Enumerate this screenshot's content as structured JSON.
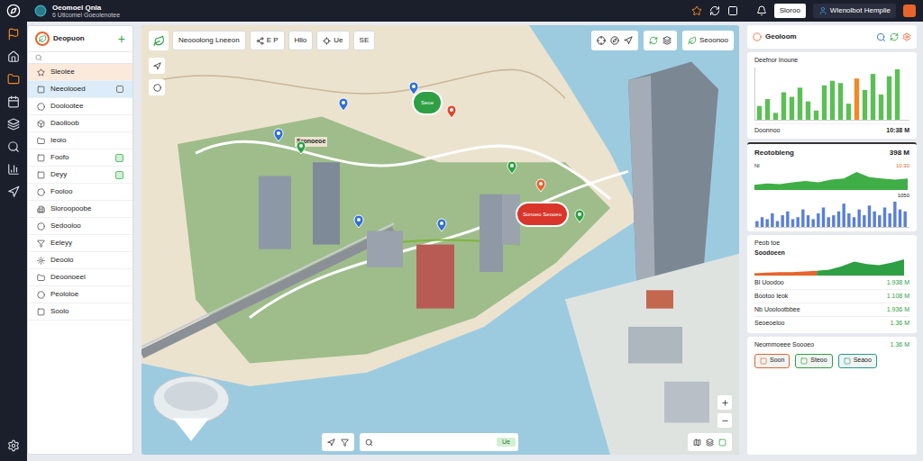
{
  "app": {
    "title": "Oeomoel Qnla",
    "subtitle": "6 Utlcomel Goeolenotee"
  },
  "rail": [
    {
      "active": true
    },
    {
      "active": false
    },
    {
      "active": true
    },
    {
      "active": false
    },
    {
      "active": false
    },
    {
      "active": false
    },
    {
      "active": false
    },
    {
      "active": false
    },
    {
      "active": false
    }
  ],
  "topbar": {
    "buttons": [
      {
        "label": "Sloroo"
      },
      {
        "label": "Wlenolbot Hemplie"
      }
    ]
  },
  "sidebar": {
    "title": "Deopuon",
    "add": "+",
    "items": [
      {
        "label": "Sleolee",
        "selected": false,
        "highlighted": true,
        "marker": "none"
      },
      {
        "label": "Neeolooed",
        "selected": true,
        "highlighted": false,
        "marker": "outline"
      },
      {
        "label": "Doolootee",
        "selected": false,
        "highlighted": false,
        "marker": "none"
      },
      {
        "label": "Daolloob",
        "selected": false,
        "highlighted": false,
        "marker": "none"
      },
      {
        "label": "Ieoio",
        "selected": false,
        "highlighted": false,
        "marker": "none"
      },
      {
        "label": "Foofo",
        "selected": false,
        "highlighted": false,
        "marker": "green"
      },
      {
        "label": "Deyy",
        "selected": false,
        "highlighted": false,
        "marker": "green"
      },
      {
        "label": "Fooloo",
        "selected": false,
        "highlighted": false,
        "marker": "none"
      },
      {
        "label": "Sloroopoobe",
        "selected": false,
        "highlighted": false,
        "marker": "none"
      },
      {
        "label": "Sedooloo",
        "selected": false,
        "highlighted": false,
        "marker": "none"
      },
      {
        "label": "Eeleyy",
        "selected": false,
        "highlighted": false,
        "marker": "none"
      },
      {
        "label": "Deoolo",
        "selected": false,
        "highlighted": false,
        "marker": "none"
      },
      {
        "label": "Deoonoeel",
        "selected": false,
        "highlighted": false,
        "marker": "none"
      },
      {
        "label": "Peololoe",
        "selected": false,
        "highlighted": false,
        "marker": "none"
      },
      {
        "label": "Soolo",
        "selected": false,
        "highlighted": false,
        "marker": "none"
      }
    ]
  },
  "map": {
    "toolbar": {
      "chips": [
        {
          "label": "Neooolong Lneeon"
        },
        {
          "label": "E P"
        },
        {
          "label": "Hllo"
        },
        {
          "label": "Ue"
        },
        {
          "label": "SE"
        }
      ],
      "layer": "Seoonoo"
    },
    "place_label": "Sronoeoe",
    "pins": [
      {
        "color": "#2f6fd6"
      },
      {
        "color": "#2ea043"
      },
      {
        "color": "#2f6fd6"
      },
      {
        "color": "#2f6fd6"
      },
      {
        "color": "#e0452c"
      },
      {
        "color": "#2ea043"
      },
      {
        "color": "#e8642c"
      },
      {
        "color": "#2f6fd6"
      },
      {
        "color": "#2f6fd6"
      },
      {
        "color": "#2ea043"
      }
    ],
    "callouts": [
      {
        "label": "Seoe",
        "color": "#2ea043"
      },
      {
        "label": "Sonoeo Seooeo",
        "color": "#d9352b"
      }
    ],
    "search": {
      "button": "Ue"
    }
  },
  "panel": {
    "title": "Geoloom",
    "income": {
      "title": "Deefnor Inoune",
      "values": [
        6,
        9,
        3,
        12,
        10,
        14,
        8,
        4,
        15,
        17,
        16,
        7,
        18,
        13,
        20,
        11,
        19,
        22
      ],
      "highlight_index": 12,
      "footer_label": "Doonnoo",
      "footer_value": "10:38 M"
    },
    "ranking": {
      "title": "Reotobleng",
      "value": "398 M",
      "area_label": "Nl",
      "area_value": "10.30",
      "area": [
        4,
        5,
        4.5,
        6,
        7,
        6,
        8,
        9,
        14,
        10,
        9,
        8,
        9
      ],
      "bars_value": "1050",
      "bars": [
        3,
        5,
        4,
        7,
        3,
        6,
        8,
        4,
        5,
        9,
        6,
        4,
        7,
        10,
        5,
        6,
        8,
        12,
        7,
        5,
        9,
        6,
        11,
        8,
        6,
        10,
        7,
        13,
        9,
        8
      ]
    },
    "summary": {
      "title": "Peob toe",
      "subtitle": "Soodoeen",
      "series": [
        {
          "color": "#e8642c",
          "values": [
            2,
            2.5,
            3,
            3,
            3.5,
            4
          ]
        },
        {
          "color": "#2ea043",
          "values": [
            4,
            5,
            8,
            12,
            10,
            9,
            11,
            14
          ]
        }
      ],
      "rows": [
        {
          "label": "Bl Uoodoo",
          "value": "1.938 M"
        },
        {
          "label": "Bootoo Ieok",
          "value": "1.108 M"
        },
        {
          "label": "Nb Uoolootbbee",
          "value": "1.936 M"
        },
        {
          "label": "Seoeoeloo",
          "value": "1.36 M"
        }
      ]
    },
    "footer": {
      "label": "Neommoeee Soooeo",
      "value": "1.36 M",
      "buttons": [
        {
          "label": "Soon",
          "color": "#e8642c"
        },
        {
          "label": "Steoo",
          "color": "#2ea043"
        },
        {
          "label": "Seaoo",
          "color": "#1f9d8a"
        }
      ]
    }
  }
}
